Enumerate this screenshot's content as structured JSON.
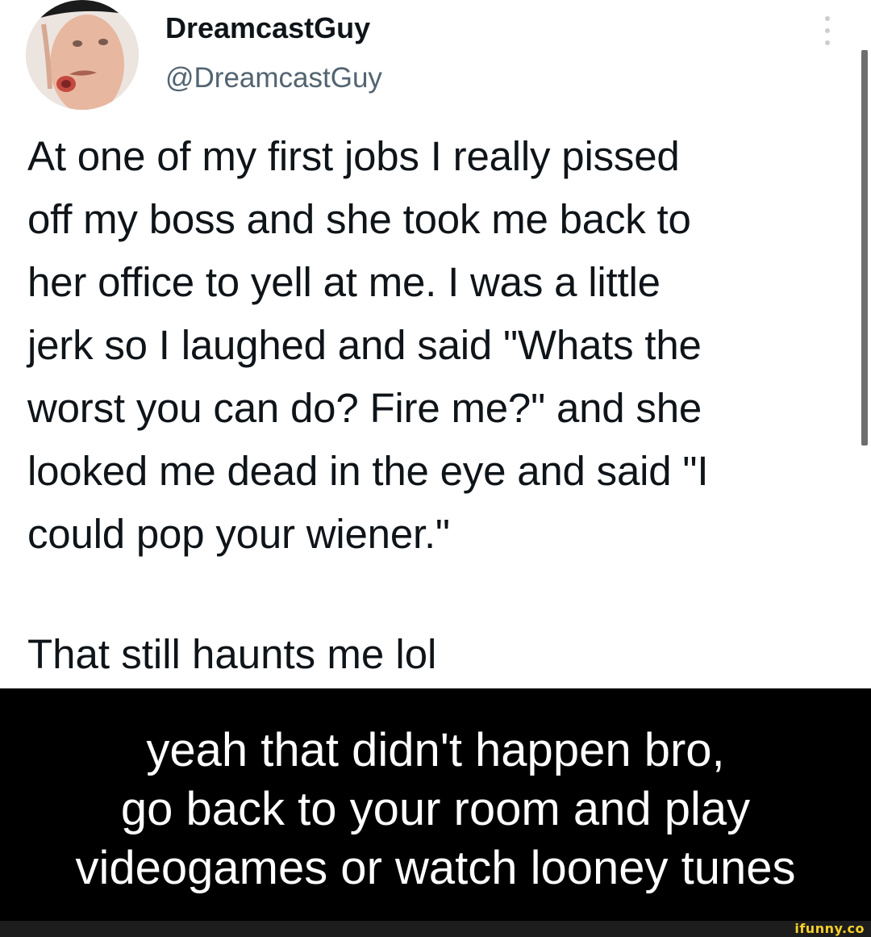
{
  "tweet": {
    "display_name": "DreamcastGuy",
    "handle": "@DreamcastGuy",
    "more_icon": "vertical-ellipsis-icon",
    "avatar_icon": "profile-photo",
    "text_lines": [
      "At one of my first jobs I really pissed",
      "off my boss and she took me back to",
      "her office to yell at me. I was a little",
      "jerk so I laughed and said \"Whats the",
      "worst you can do? Fire me?\" and she",
      "looked me dead in the eye and said \"I",
      "could pop your wiener.\""
    ],
    "second_paragraph": "That still haunts me lol"
  },
  "caption": {
    "lines": [
      "yeah that didn't happen bro,",
      "go back to your room and play",
      "videogames or watch looney tunes"
    ]
  },
  "watermark": {
    "text": "ifunny.co"
  },
  "colors": {
    "name_text": "#0f1419",
    "handle_text": "#536471",
    "caption_bg": "#000000",
    "caption_text": "#ffffff",
    "watermark": "#f7d02c"
  }
}
